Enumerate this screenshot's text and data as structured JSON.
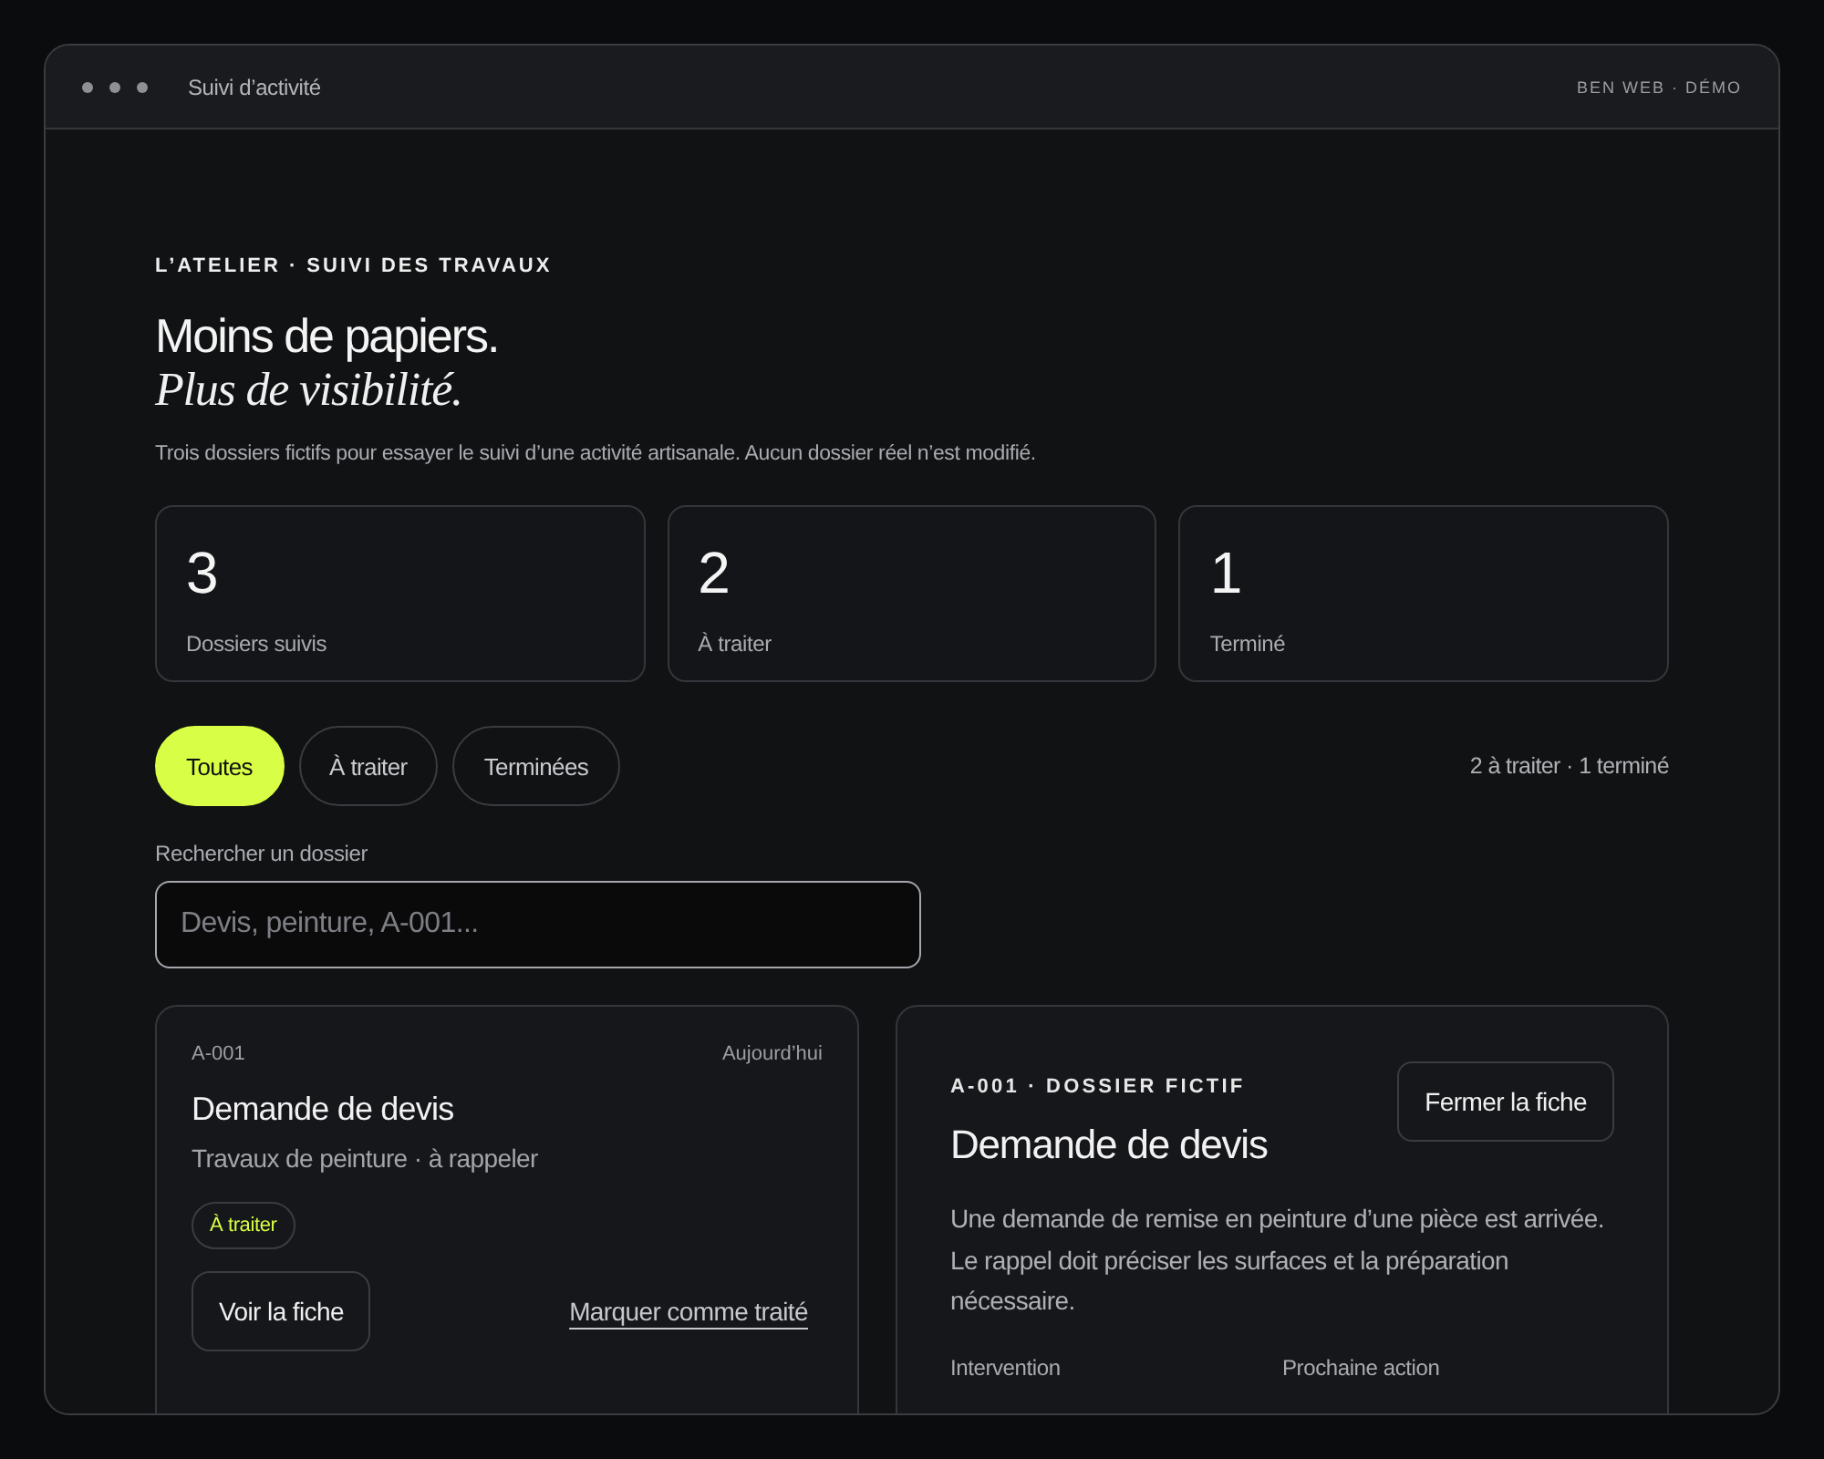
{
  "window": {
    "title": "Suivi d’activité",
    "brand": "BEN WEB · DÉMO"
  },
  "hero": {
    "eyebrow": "L’ATELIER · SUIVI DES TRAVAUX",
    "headline": "Moins de papiers.",
    "headline_italic": "Plus de visibilité.",
    "intro": "Trois dossiers fictifs pour essayer le suivi d’une activité artisanale. Aucun dossier réel n’est modifié."
  },
  "stats": [
    {
      "value": "3",
      "label": "Dossiers suivis"
    },
    {
      "value": "2",
      "label": "À traiter"
    },
    {
      "value": "1",
      "label": "Terminé"
    }
  ],
  "filters": [
    {
      "label": "Toutes",
      "selected": true
    },
    {
      "label": "À traiter",
      "selected": false
    },
    {
      "label": "Terminées",
      "selected": false
    }
  ],
  "filter_summary": "2 à traiter · 1 terminé",
  "search": {
    "label": "Rechercher un dossier",
    "placeholder": "Devis, peinture, A-001..."
  },
  "dossier": {
    "id": "A-001",
    "date": "Aujourd’hui",
    "title": "Demande de devis",
    "subtitle": "Travaux de peinture · à rappeler",
    "status": "À traiter",
    "primary_button": "Voir la fiche",
    "link": "Marquer comme traité"
  },
  "detail": {
    "eyebrow": "A-001 · DOSSIER FICTIF",
    "title": "Demande de devis",
    "close_button": "Fermer la fiche",
    "description": "Une demande de remise en peinture d’une pièce est arrivée. Le rappel doit préciser les surfaces et la préparation nécessaire.",
    "fields": [
      "Intervention",
      "Prochaine action"
    ]
  }
}
